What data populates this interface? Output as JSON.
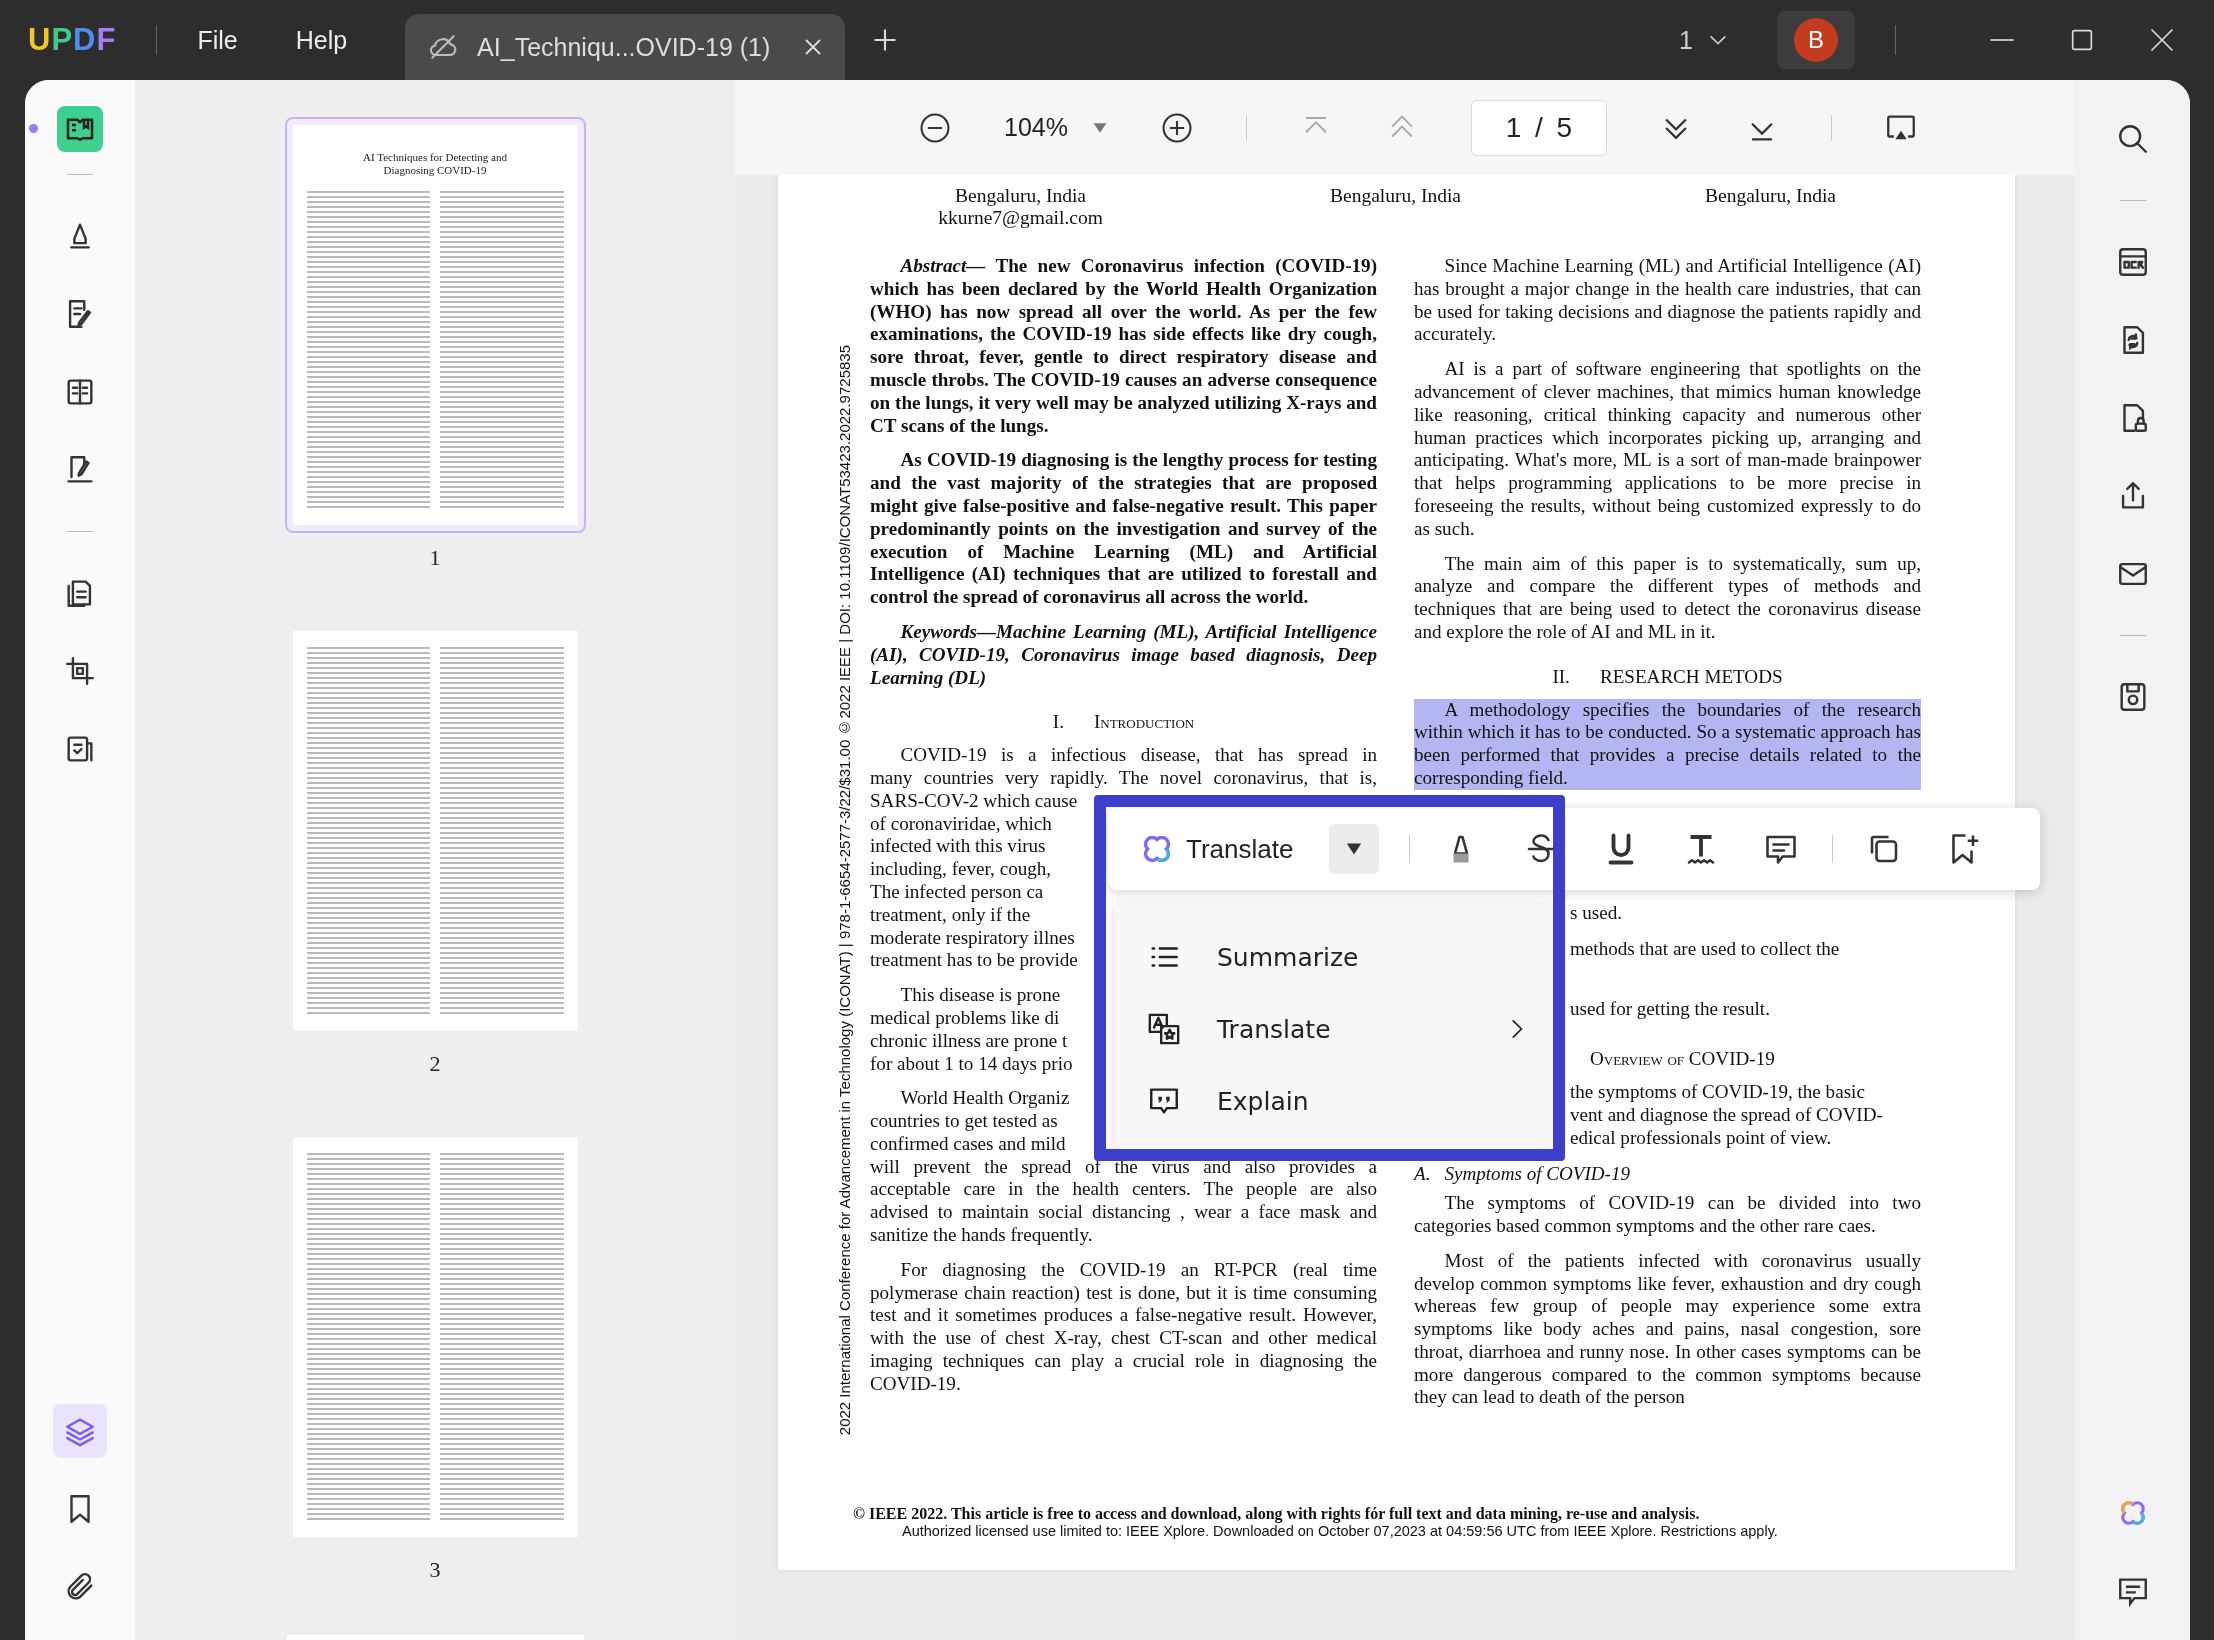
{
  "title_bar": {
    "logo": "UPDF",
    "menu": [
      "File",
      "Help"
    ],
    "tab": {
      "title": "AI_Techniqu...OVID-19 (1)",
      "selected": true
    },
    "page_picker": "1",
    "avatar": "B"
  },
  "left_rail": {
    "top": [
      {
        "selected": true
      }
    ],
    "middle": [
      {
        "selected": false
      },
      {
        "selected": false
      },
      {
        "selected": false
      },
      {
        "selected": false
      }
    ],
    "lower": [
      {
        "selected": false
      },
      {
        "selected": false
      },
      {
        "selected": false
      }
    ],
    "bottom": [
      {
        "selected": true
      },
      {
        "selected": false
      },
      {
        "selected": false
      }
    ]
  },
  "thumbnails": [
    {
      "label": "1",
      "selected": true,
      "title": "AI Techniques for Detecting and Diagnosing COVID-19"
    },
    {
      "label": "2",
      "selected": false
    },
    {
      "label": "3",
      "selected": false
    }
  ],
  "viewer_toolbar": {
    "zoom": "104%",
    "page_field": "1 / 5"
  },
  "document": {
    "side_note": "2022 International Conference for Advancement in Technology (ICONAT) | 978-1-6654-2577-3/22/$31.00 ©2022 IEEE | DOI: 10.1109/ICONAT53423.2022.9725835",
    "affiliations": [
      {
        "lines": [
          "Bengaluru, India",
          "kkurne7@gmail.com"
        ]
      },
      {
        "lines": [
          "Bengaluru, India"
        ]
      },
      {
        "lines": [
          "Bengaluru, India"
        ]
      }
    ],
    "left_column": [
      {
        "kind": "abstract",
        "text": "*Abstract—* The new Coronavirus infection (COVID-19) which has been declared by the World Health Organization (WHO) has now spread all over the world. As per the few examinations, the COVID-19 has side effects like dry cough, sore throat, fever, gentle to direct respiratory disease and muscle throbs. The COVID-19 causes an adverse consequence on the lungs, it very well may be analyzed utilizing X-rays and CT scans of the lungs."
      },
      {
        "kind": "bold_paragraph",
        "text": "As COVID-19 diagnosing is the lengthy process for testing and the vast majority of the strategies that are proposed might give false-positive and false-negative result. This paper predominantly points on the investigation and survey of the execution of Machine Learning (ML) and Artificial Intelligence (AI) techniques that are utilized to forestall and control the spread of coronavirus all across the world."
      },
      {
        "kind": "keywords",
        "text": "Keywords—Machine Learning (ML), Artificial Intelligence (AI), COVID-19, Coronavirus image based diagnosis, Deep Learning (DL)"
      },
      {
        "kind": "heading",
        "number": "I.",
        "title": "Introduction",
        "small_caps": true
      },
      {
        "kind": "lines",
        "lines": [
          {
            "text": "COVID-19 is a infectious disease, that has spread in",
            "cut": false
          },
          {
            "text": "many countries very rapidly. The novel coronavirus, that is,",
            "cut": false
          },
          {
            "text": "SARS-COV-2 which cause",
            "cut": true
          },
          {
            "text": "of coronaviridae, which",
            "cut": true
          },
          {
            "text": "infected with this virus",
            "cut": true
          },
          {
            "text": "including, fever, cough,",
            "cut": true
          },
          {
            "text": "The infected person ca",
            "cut": true
          },
          {
            "text": "treatment, only if the",
            "cut": true
          },
          {
            "text": "moderate respiratory illnes",
            "cut": true
          },
          {
            "text": "treatment has to be provide",
            "cut": true
          }
        ]
      },
      {
        "kind": "lines",
        "lines": [
          {
            "text": "This disease is prone",
            "cut": true
          },
          {
            "text": "medical problems like di",
            "cut": true
          },
          {
            "text": "chronic illness are prone t",
            "cut": true
          },
          {
            "text": "for about 1 to 14 days prio",
            "cut": true
          }
        ]
      },
      {
        "kind": "lines",
        "lines": [
          {
            "text": "World Health Organiz",
            "cut": true
          },
          {
            "text": "countries to get tested as",
            "cut": true
          },
          {
            "text": "confirmed cases and mild",
            "cut": true
          },
          {
            "text": "will prevent the spread of the virus and also provides a",
            "cut": false
          },
          {
            "text": "acceptable care in the health centers. The people are also",
            "cut": false
          },
          {
            "text": "advised to maintain social distancing , wear a face mask and",
            "cut": false
          },
          {
            "text": "sanitize the hands frequently.",
            "cut": false
          }
        ]
      },
      {
        "kind": "paragraph",
        "text": "For diagnosing the COVID-19 an RT-PCR (real time polymerase chain reaction) test is done, but it is time consuming test and it sometimes produces a false-negative result. However, with the use of chest X-ray, chest CT-scan and other medical imaging techniques can play a crucial role in diagnosing the COVID-19."
      }
    ],
    "right_column": [
      {
        "kind": "paragraph",
        "text": "Since Machine Learning (ML) and Artificial Intelligence (AI) has brought a major change in the health care industries, that can be used for taking decisions and diagnose the patients rapidly and accurately.",
        "selected": false
      },
      {
        "kind": "paragraph",
        "text": "AI is a part of software engineering that spotlights on the advancement of clever machines, that mimics human knowledge like reasoning, critical thinking capacity and numerous other human practices which incorporates picking up, arranging and anticipating. What's more, ML is a sort of man-made brainpower that helps programming applications to be more precise in foreseeing the results, without being customized expressly to do as such.",
        "selected": false
      },
      {
        "kind": "paragraph",
        "text": "The main aim of this paper is to systematically, sum up, analyze and compare the different types of methods and techniques that are being used to detect the coronavirus disease and explore the role of AI and ML in it.",
        "selected": false
      },
      {
        "kind": "heading",
        "number": "II.",
        "title": "RESEARCH METODS"
      },
      {
        "kind": "paragraph",
        "text": "A methodology specifies the boundaries of the research within which it has to be conducted. So a systematic approach has been performed that provides a precise details related to the corresponding field.",
        "selected": true
      },
      {
        "kind": "fragments",
        "lines": [
          {
            "kind": "text",
            "text": "s used."
          },
          {
            "kind": "text",
            "text": "methods that are used to collect the"
          },
          {
            "kind": "text",
            "text": "used for getting the result."
          },
          {
            "kind": "heading",
            "text": "Overview of COVID-19"
          },
          {
            "kind": "text",
            "text": "the symptoms of COVID-19, the basic"
          },
          {
            "kind": "text",
            "text": "vent and diagnose the spread of COVID-"
          },
          {
            "kind": "text",
            "text": "edical professionals point of view."
          }
        ]
      },
      {
        "kind": "subheading",
        "number": "A.",
        "title": "Symptoms of COVID-19"
      },
      {
        "kind": "paragraph",
        "text": "The symptoms of COVID-19 can be divided into two categories based common symptoms and the other rare caes.",
        "selected": false
      },
      {
        "kind": "paragraph",
        "text": "Most of the patients infected with coronavirus usually develop common symptoms like fever, exhaustion and dry cough whereas few group of people may experience some extra symptoms like body aches and pains, nasal congestion, sore throat, diarrhoea and runny nose. In other cases symptoms can be more dangerous compared to the common symptoms because they can lead to death of the person",
        "selected": false
      }
    ],
    "footer": {
      "notice": "© IEEE 2022. This article is free to access and download, along with rights fór full text and data mining, re-use and analysis.",
      "license": "Authorized licensed use limited to: IEEE Xplore. Downloaded on October 07,2023 at 04:59:56 UTC from IEEE Xplore.  Restrictions apply."
    }
  },
  "ai_popup": {
    "action": "Translate",
    "menu": [
      {
        "label": "Summarize",
        "submenu": false
      },
      {
        "label": "Translate",
        "submenu": true
      },
      {
        "label": "Explain",
        "submenu": false
      }
    ]
  }
}
